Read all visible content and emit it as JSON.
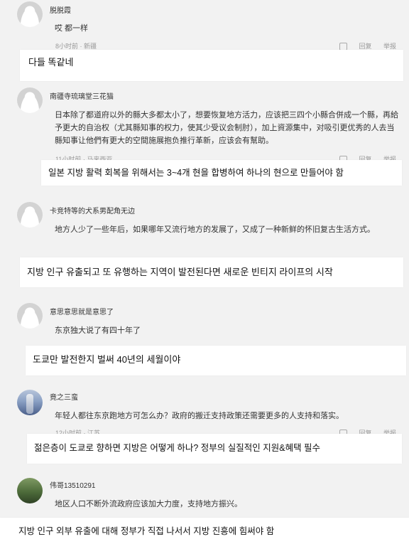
{
  "comments": [
    {
      "username": "脱脱霞",
      "text": "哎 都一样",
      "meta": "8小时前 · 新疆",
      "reply": "回复",
      "report": "举报",
      "translation": "다들 똑같네"
    },
    {
      "username": "南疆寺琉璃堂三花猫",
      "text": "日本除了都道府以外的縣大多都太小了，想要恢复地方活力，应该把三四个小縣合併成一个縣，再給予更大的自治权（尤其縣知事的权力，使其少受议会制肘），加上資源集中，对吸引更优秀的人去当縣知事让他們有更大的空間施展抱负推行革新，应该会有幫助。",
      "meta": "11小时前 · 马来西亚",
      "reply": "回复",
      "report": "举报",
      "translation": "일본 지방 활력 회복을 위해서는 3~4개 현을 합병하여 하나의 현으로 만들어야 함"
    },
    {
      "username": "卡竞特等的犬系男配角无边",
      "text": "地方人少了一些年后，如果哪年又流行地方的发展了，又成了一种新鲜的怀旧复古生活方式。",
      "meta": "",
      "reply": "",
      "report": "",
      "translation": "지방 인구 유출되고 또 유행하는 지역이 발전된다면 새로운 빈티지 라이프의 시작"
    },
    {
      "username": "意思意思就是意思了",
      "text": "东京独大说了有四十年了",
      "meta": "",
      "reply": "",
      "report": "",
      "translation": "도쿄만 발전한지 벌써 40년의 세월이야"
    },
    {
      "username": "竟之三蛮",
      "text": "年轻人都往东京跑地方可怎么办？政府的搬迁支持政策还需要更多的人支持和落实。",
      "meta": "12小时前 · 江苏",
      "reply": "回复",
      "report": "举报",
      "translation": "젊은층이 도쿄로 향하면 지방은 어떻게 하나? 정부의 실질적인 지원&혜택 필수"
    },
    {
      "username": "伟哥13510291",
      "text": "地区人口不断外流政府应该加大力度，支持地方振兴。",
      "meta": "",
      "reply": "",
      "report": "",
      "translation": "지방 인구 외부 유출에 대해 정부가 직접 나서서 지방 진흥에 힘써야 함"
    }
  ]
}
